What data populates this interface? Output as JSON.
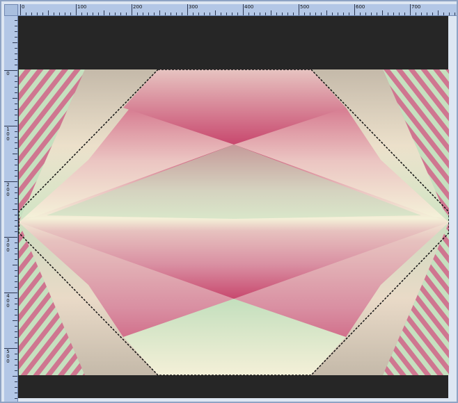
{
  "rulers": {
    "top_labels": [
      "0",
      "100",
      "200",
      "300",
      "400",
      "500",
      "600",
      "700"
    ],
    "left_labels": [
      "0",
      "100",
      "200",
      "300",
      "400",
      "500"
    ]
  },
  "colors": {
    "workspace": "#262626",
    "ruler": "#b3c7e6",
    "rose": "#c8486e",
    "mint": "#c3dfbd",
    "cream": "#f4f0d8"
  },
  "selection": {
    "style": "marching-ants"
  }
}
